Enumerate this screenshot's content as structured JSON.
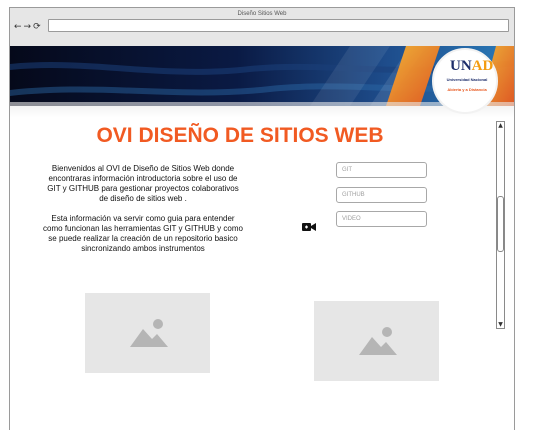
{
  "window": {
    "title": "Diseño Sitios Web",
    "url": ""
  },
  "nav": {
    "back_icon": "←",
    "forward_icon": "→",
    "reload_icon": "⟳"
  },
  "logo": {
    "word_main": "UN",
    "word_accent": "AD",
    "line1": "Universidad Nacional",
    "line2": "Abierta y a Distancia"
  },
  "page": {
    "title": "OVI DISEÑO DE SITIOS WEB",
    "intro_p1": "Bienvenidos al OVI de Diseño de Sitios Web donde encontraras información introductoria sobre el uso de GIT y GITHUB para gestionar proyectos colaborativos de diseño de sitios web .",
    "intro_p2": "Esta información va servir como guia para entender como funcionan las herramientas GIT y GITHUB y como se puede realizar la creación de un repositorio basico sincronizando ambos instrumentos"
  },
  "fields": {
    "git_placeholder": "GIT",
    "github_placeholder": "GITHUB",
    "video_placeholder": "VIDEO"
  },
  "scrollbar": {
    "up": "▲",
    "down": "▼"
  },
  "colors": {
    "title": "#f15a22",
    "banner_dark": "#0a1330",
    "banner_orange": "#f39c12",
    "placeholder_bg": "#e6e6e6"
  }
}
